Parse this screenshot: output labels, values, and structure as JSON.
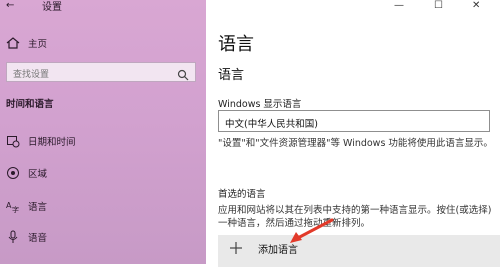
{
  "window": {
    "title": "设置",
    "controls": [
      "—",
      "☐",
      "✕"
    ]
  },
  "sidebar": {
    "home": "主页",
    "search_placeholder": "查找设置",
    "section_title": "时间和语言",
    "items": [
      {
        "label": "日期和时间",
        "icon": "calendar-clock-icon"
      },
      {
        "label": "区域",
        "icon": "globe-icon"
      },
      {
        "label": "语言",
        "icon": "language-icon"
      },
      {
        "label": "语音",
        "icon": "microphone-icon"
      }
    ]
  },
  "main": {
    "title": "语言",
    "subtitle": "语言",
    "display_language_label": "Windows 显示语言",
    "display_language_value": "中文(中华人民共和国)",
    "display_language_desc": "\"设置\"和\"文件资源管理器\"等 Windows 功能将使用此语言显示。",
    "preferred_title": "首选的语言",
    "preferred_desc": "应用和网站将以其在列表中支持的第一种语言显示。按住(或选择)一种语言，然后通过拖动重新排列。",
    "add_language_label": "添加语言"
  },
  "colors": {
    "sidebar_bg": "#d2a1cf",
    "accent_arrow": "#e23a2a"
  }
}
